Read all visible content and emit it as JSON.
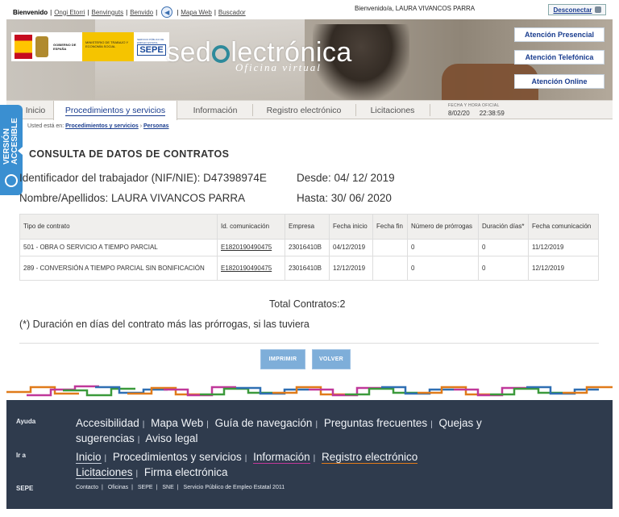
{
  "topbar": {
    "links": [
      "Bienvenido",
      "Ongi Etorri",
      "Benvinguts",
      "Benvido"
    ],
    "link2": [
      "Mapa Web",
      "Buscador"
    ],
    "welcome": "Bienvenido/a, LAURA VIVANCOS PARRA",
    "logout": "Desconectar"
  },
  "header": {
    "gobierno": "GOBIERNO DE ESPAÑA",
    "ministerio": "MINISTERIO DE TRABAJO Y ECONOMÍA SOCIAL",
    "sepe_small": "SERVICIO PÚBLICO DE EMPLEO ESTATAL",
    "sepe": "SEPE",
    "title_a": "sed",
    "title_b": "lectrónica",
    "subtitle": "Oficina virtual",
    "buttons": [
      "Atención Presencial",
      "Atención Telefónica",
      "Atención Online"
    ]
  },
  "tabs": [
    "Inicio",
    "Procedimientos y servicios",
    "Información",
    "Registro electrónico",
    "Licitaciones"
  ],
  "datetime": {
    "label": "FECHA Y HORA OFICIAL",
    "date": "8/02/20",
    "time": "22:38:59"
  },
  "accessibility": {
    "line1": "VERSIÓN",
    "line2": "ACCESIBLE"
  },
  "breadcrumb": {
    "prefix": "Usted está en:",
    "items": [
      "Procedimientos y servicios",
      "Personas"
    ]
  },
  "title": "CONSULTA DE DATOS DE CONTRATOS",
  "info": {
    "id_label": "Identificador del trabajador (NIF/NIE): D47398974E",
    "name_label": "Nombre/Apellidos: LAURA VIVANCOS PARRA",
    "desde": "Desde: 04/ 12/ 2019",
    "hasta": "Hasta: 30/ 06/ 2020"
  },
  "table": {
    "headers": [
      "Tipo de contrato",
      "Id. comunicación",
      "Empresa",
      "Fecha inicio",
      "Fecha fin",
      "Número de prórrogas",
      "Duración días*",
      "Fecha comunicación"
    ],
    "rows": [
      [
        "501  -  OBRA O SERVICIO A TIEMPO PARCIAL",
        "E1820190490475",
        "23016410B",
        "04/12/2019",
        "",
        "0",
        "0",
        "11/12/2019"
      ],
      [
        "289  -  CONVERSIÓN A TIEMPO PARCIAL SIN BONIFICACIÓN",
        "E1820190490475",
        "23016410B",
        "12/12/2019",
        "",
        "0",
        "0",
        "12/12/2019"
      ]
    ]
  },
  "total": "Total Contratos:2",
  "note": "(*) Duración en días del contrato más las prórrogas, si las tuviera",
  "buttons": {
    "print": "IMPRIMIR",
    "back": "VOLVER"
  },
  "footer": {
    "ayuda_label": "Ayuda",
    "ayuda": [
      "Accesibilidad",
      "Mapa Web",
      "Guía de navegación",
      "Preguntas frecuentes",
      "Quejas y sugerencias",
      "Aviso legal"
    ],
    "ira_label": "Ir a",
    "ira": [
      "Inicio",
      "Procedimientos y servicios",
      "Información",
      "Registro electrónico",
      "Licitaciones",
      "Firma electrónica"
    ],
    "sepe_label": "SEPE",
    "sepe": [
      "Contacto",
      "Oficinas",
      "SEPE",
      "SNE",
      "Servicio Público de Empleo Estatal 2011"
    ]
  },
  "colors": {
    "primary_blue": "#1a3d8f",
    "accessibility_tab": "#3a8fd1",
    "button_blue": "#7eaed9",
    "footer_bg": "#2f3b4d"
  }
}
